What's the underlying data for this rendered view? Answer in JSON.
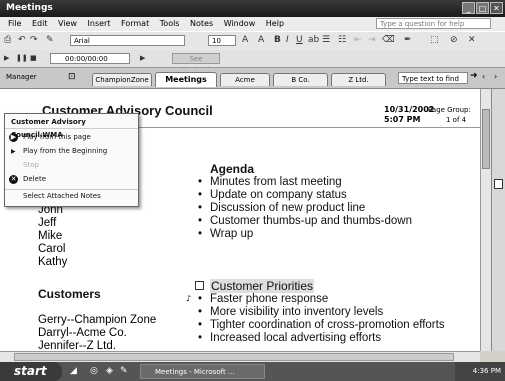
{
  "window": {
    "title": "Meetings"
  },
  "menu": {
    "items": [
      "File",
      "Edit",
      "View",
      "Insert",
      "Format",
      "Tools",
      "Notes",
      "Window",
      "Help"
    ],
    "ask_placeholder": "Type a question for help"
  },
  "toolbar": {
    "font": "Arial",
    "size": "10"
  },
  "audio": {
    "time": "00:00/00:00",
    "see_playback": "See Playback"
  },
  "nav": {
    "section": "Manager",
    "tabs": [
      "ChampionZone",
      "Meetings",
      "Acme",
      "B Co.",
      "Z Ltd."
    ],
    "find_placeholder": "Type text to find"
  },
  "page": {
    "title": "Customer Advisory Council",
    "date": "10/31/2002",
    "time": "5:07 PM",
    "page_group_label": "Page Group:",
    "page_group_value": "1 of 4",
    "agenda_heading": "Agenda",
    "agenda_items": [
      "Minutes from last meeting",
      "Update on company status",
      "Discussion of new product line",
      "Customer thumbs-up and thumbs-down",
      "Wrap up"
    ],
    "people": [
      "John",
      "Jeff",
      "Mike",
      "Carol",
      "Kathy"
    ],
    "customers_heading": "Customers",
    "customers": [
      "Gerry--Champion Zone",
      "Darryl--Acme Co.",
      "Jennifer--Z Ltd."
    ],
    "priorities_heading": "Customer Priorities",
    "priorities": [
      "Faster phone response",
      "More visibility into inventory levels",
      "Tighter coordination of cross-promotion efforts",
      "Increased local advertising efforts"
    ]
  },
  "popup": {
    "header": "Customer Advisory Council.WMA",
    "items": [
      "Play from this page",
      "Play from the Beginning",
      "Stop",
      "Delete",
      "Select Attached Notes"
    ]
  },
  "taskbar": {
    "start": "start",
    "task": "Meetings - Microsoft ...",
    "clock": "4:36 PM"
  }
}
